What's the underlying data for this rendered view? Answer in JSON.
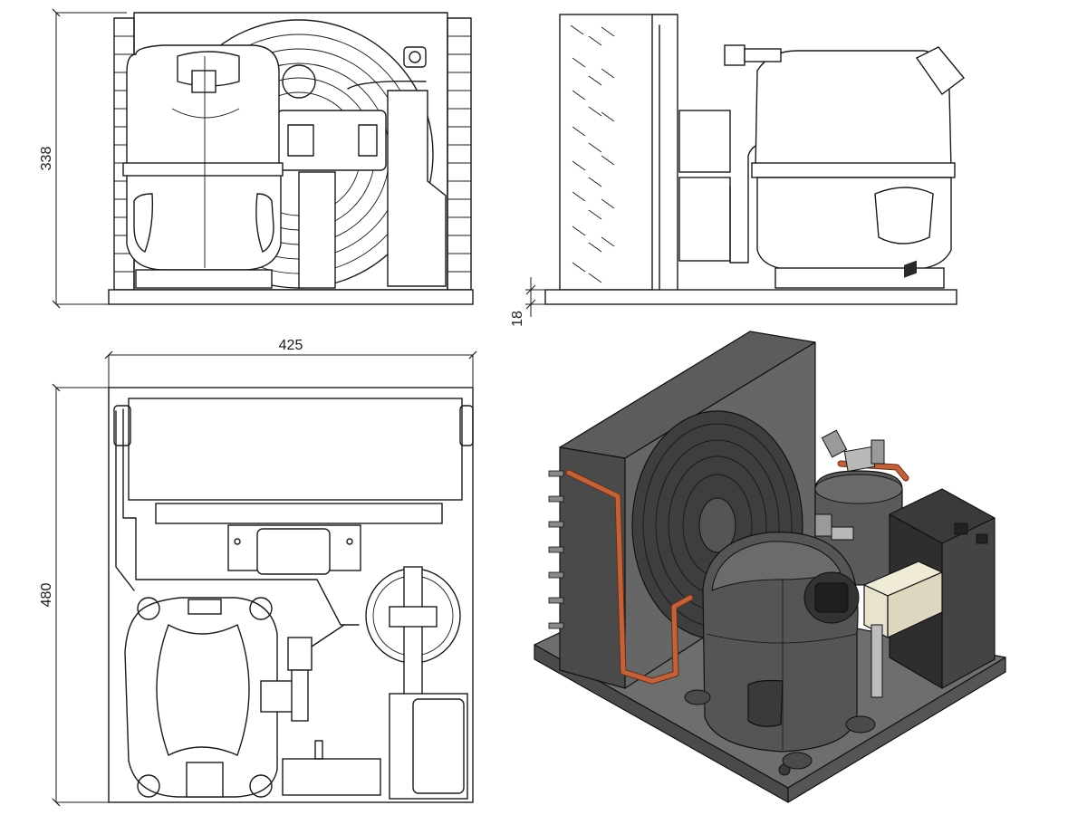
{
  "dimensions": {
    "height_front": "338",
    "base_thickness": "18",
    "width_top": "425",
    "depth_top": "480"
  },
  "colors": {
    "line": "#1a1a1a",
    "body_dark": "#4a4a4a",
    "body_mid": "#5c5c5c",
    "body_light": "#6e6e6e",
    "copper": "#c0623b",
    "label": "#e8e3cf"
  }
}
